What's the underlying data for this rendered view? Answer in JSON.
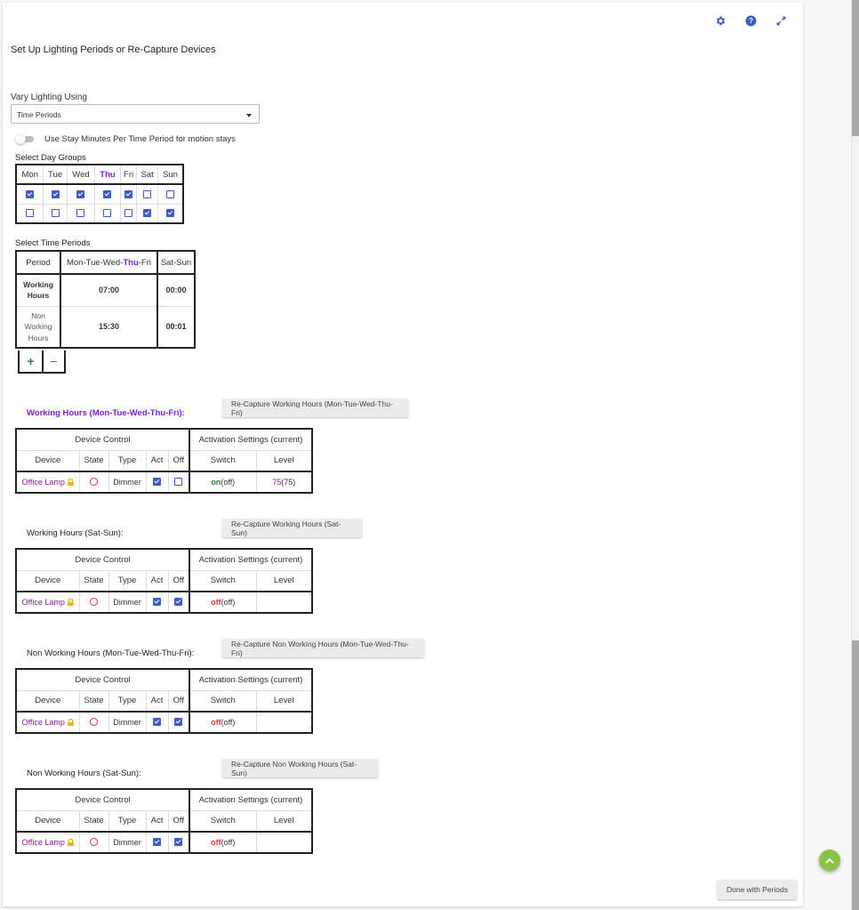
{
  "header": {
    "icons": [
      "gear-icon",
      "help-icon",
      "expand-icon"
    ],
    "accent_color": "#3d5cc7"
  },
  "page": {
    "title": "Set Up Lighting Periods or Re-Capture Devices",
    "vary_label": "Vary Lighting Using",
    "vary_value": "Time Periods",
    "toggle_label": "Use Stay Minutes Per Time Period for motion stays",
    "toggle_on": false
  },
  "day_groups": {
    "label": "Select Day Groups",
    "days": [
      "Mon",
      "Tue",
      "Wed",
      "Thu",
      "Fri",
      "Sat",
      "Sun"
    ],
    "today": "Thu",
    "rows": [
      [
        true,
        true,
        true,
        true,
        true,
        false,
        false
      ],
      [
        false,
        false,
        false,
        false,
        false,
        true,
        true
      ]
    ]
  },
  "time_periods": {
    "label": "Select Time Periods",
    "headers": {
      "period": "Period",
      "g1_pre": "Mon-Tue-Wed-",
      "g1_thu": "Thu",
      "g1_post": "-Fri",
      "g2": "Sat-Sun"
    },
    "rows": [
      {
        "name": "Working Hours",
        "g1": "07:00",
        "g2": "00:00",
        "active": true
      },
      {
        "name": "Non Working Hours",
        "g1": "15:30",
        "g2": "00:01",
        "active": false
      }
    ],
    "add_label": "+",
    "remove_label": "−"
  },
  "table_headers": {
    "device_control": "Device Control",
    "activation": "Activation Settings (current)",
    "device": "Device",
    "state": "State",
    "type": "Type",
    "act": "Act",
    "off": "Off",
    "switch": "Switch",
    "level": "Level"
  },
  "groups": [
    {
      "title": "Working Hours (Mon-Tue-Wed-Thu-Fri):",
      "button": "Re-Capture Working Hours (Mon-Tue-Wed-Thu-Fri)",
      "device": "Office Lamp",
      "type": "Dimmer",
      "act": true,
      "off": false,
      "switch": "on",
      "switch_current": "(off)",
      "level": "75",
      "level_current": "(75)"
    },
    {
      "title": "Working Hours (Sat-Sun):",
      "button": "Re-Capture Working Hours (Sat-Sun)",
      "device": "Office Lamp",
      "type": "Dimmer",
      "act": true,
      "off": true,
      "switch": "off",
      "switch_current": "(off)",
      "level": "",
      "level_current": ""
    },
    {
      "title": "Non Working Hours (Mon-Tue-Wed-Thu-Fri):",
      "button": "Re-Capture Non Working Hours (Mon-Tue-Wed-Thu-Fri)",
      "device": "Office Lamp",
      "type": "Dimmer",
      "act": true,
      "off": true,
      "switch": "off",
      "switch_current": "(off)",
      "level": "",
      "level_current": ""
    },
    {
      "title": "Non Working Hours (Sat-Sun):",
      "button": "Re-Capture Non Working Hours (Sat-Sun)",
      "device": "Office Lamp",
      "type": "Dimmer",
      "act": true,
      "off": true,
      "switch": "off",
      "switch_current": "(off)",
      "level": "",
      "level_current": ""
    }
  ],
  "footer": {
    "done_label": "Done with Periods"
  }
}
